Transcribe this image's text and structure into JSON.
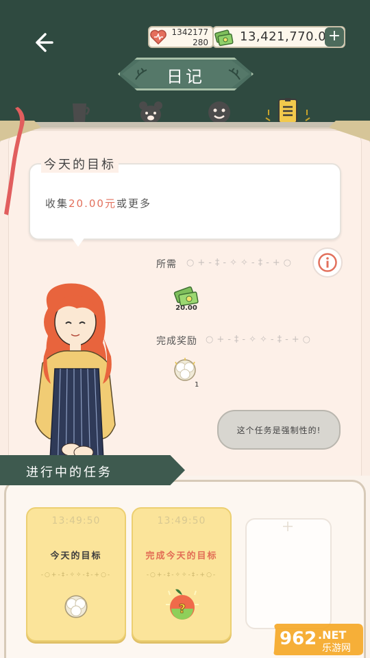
{
  "header": {
    "title": "日记",
    "hearts_top": "1342177",
    "hearts_bottom": "280",
    "money": "13,421,770.00",
    "add_label": "+"
  },
  "tabs": [
    {
      "name": "cup-icon",
      "active": false
    },
    {
      "name": "bear-icon",
      "active": false
    },
    {
      "name": "face-icon",
      "active": false
    },
    {
      "name": "diary-icon",
      "active": true
    }
  ],
  "goal": {
    "title": "今天的目标",
    "desc_prefix": "收集",
    "desc_amount": "20.00元",
    "desc_suffix": "或更多",
    "required_label": "所需",
    "required_count": "20.00",
    "reward_label": "完成奖励",
    "reward_count": "1",
    "dots": "○+-‡-✧✧-‡-+○",
    "mandatory_note": "这个任务是强制性的!"
  },
  "active": {
    "section_title": "进行中的任务",
    "cards": [
      {
        "time": "13:49:50",
        "title": "今天的目标",
        "title_color": "#3d3d3d",
        "reward": "cotton"
      },
      {
        "time": "13:49:50",
        "title": "完成今天的目标",
        "title_color": "#e26d55",
        "reward": "mystery-apple"
      }
    ],
    "card_dots": "-○+-‡-✧✧-‡-+○-"
  },
  "watermark": {
    "brand": "962",
    "suffix": ".NET",
    "sub": "乐游网"
  },
  "colors": {
    "bg_dark": "#2f4a40",
    "accent_green": "#4d7062",
    "paper": "#fdf0e8",
    "card_yellow": "#fbe49a",
    "highlight_red": "#e2705c"
  }
}
